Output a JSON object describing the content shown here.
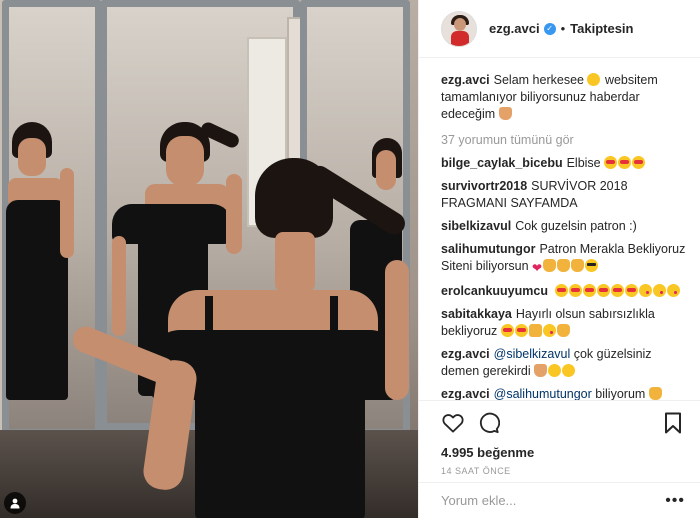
{
  "post": {
    "username": "ezg.avci",
    "follow_status": "Takiptesin",
    "separator": "•",
    "caption": "Selam herkesee",
    "caption_rest": "websitem tamamlanıyor biliyorsunuz haberdar edeceğim",
    "view_all_comments": "37 yorumun tümünü gör",
    "likes": "4.995 beğenme",
    "time_ago": "14 SAAT ÖNCE"
  },
  "comments": [
    {
      "user": "bilge_caylak_bicebu",
      "text": "Elbise",
      "emojis": [
        "heart-eyes",
        "heart-eyes",
        "heart-eyes"
      ]
    },
    {
      "user": "survivortr2018",
      "text": "SURVİVOR 2018 FRAGMANI SAYFAMDA",
      "emojis": []
    },
    {
      "user": "sibelkizavul",
      "text": "Cok guzelsin patron :)",
      "emojis": []
    },
    {
      "user": "salihumutungor",
      "text": "Patron Merakla Bekliyoruz Siteni biliyorsun",
      "emojis": [
        "red-heart",
        "pray",
        "pray",
        "pray",
        "sunglasses"
      ]
    },
    {
      "user": "erolcankuuyumcu",
      "text": "",
      "emojis": [
        "heart-eyes",
        "heart-eyes",
        "heart-eyes",
        "heart-eyes",
        "heart-eyes",
        "heart-eyes",
        "kiss",
        "kiss",
        "kiss"
      ]
    },
    {
      "user": "sabitakkaya",
      "text": "Hayırlı olsun sabırsızlıkla bekliyoruz",
      "emojis": [
        "heart-eyes",
        "heart-eyes",
        "ok-hand",
        "kiss",
        "pray"
      ]
    },
    {
      "user": "ezg.avci",
      "mention": "@sibelkizavul",
      "text": "çok güzelsiniz demen gerekirdi",
      "emojis": [
        "hand",
        "grin",
        "grin"
      ]
    },
    {
      "user": "ezg.avci",
      "mention": "@salihumutungor",
      "text": "biliyorum",
      "emojis": [
        "pray"
      ]
    }
  ],
  "add_comment": {
    "placeholder": "Yorum ekle..."
  },
  "more_options": "•••",
  "icons": {
    "like": "heart-outline-icon",
    "comment": "comment-bubble-icon",
    "save": "bookmark-icon",
    "verified": "verified-badge-icon",
    "tagged_users": "user-tag-icon"
  },
  "colors": {
    "verified": "#3897f0",
    "mention": "#003569",
    "muted": "#999999"
  }
}
